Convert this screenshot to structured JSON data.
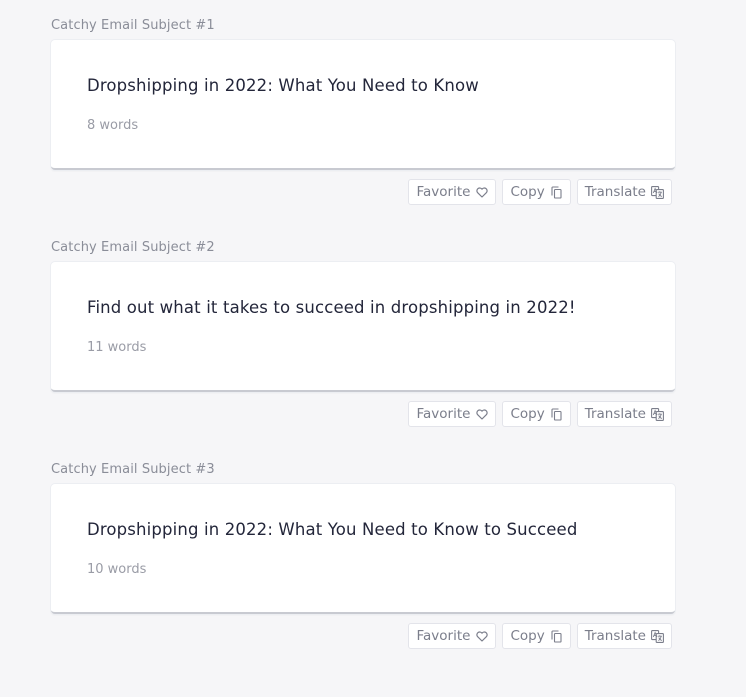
{
  "actions": {
    "favorite_label": "Favorite",
    "copy_label": "Copy",
    "translate_label": "Translate"
  },
  "results": [
    {
      "label": "Catchy Email Subject #1",
      "text": "Dropshipping in 2022: What You Need to Know",
      "word_count": "8 words"
    },
    {
      "label": "Catchy Email Subject #2",
      "text": "Find out what it takes to succeed in dropshipping in 2022!",
      "word_count": "11 words"
    },
    {
      "label": "Catchy Email Subject #3",
      "text": "Dropshipping in 2022: What You Need to Know to Succeed",
      "word_count": "10 words"
    }
  ]
}
